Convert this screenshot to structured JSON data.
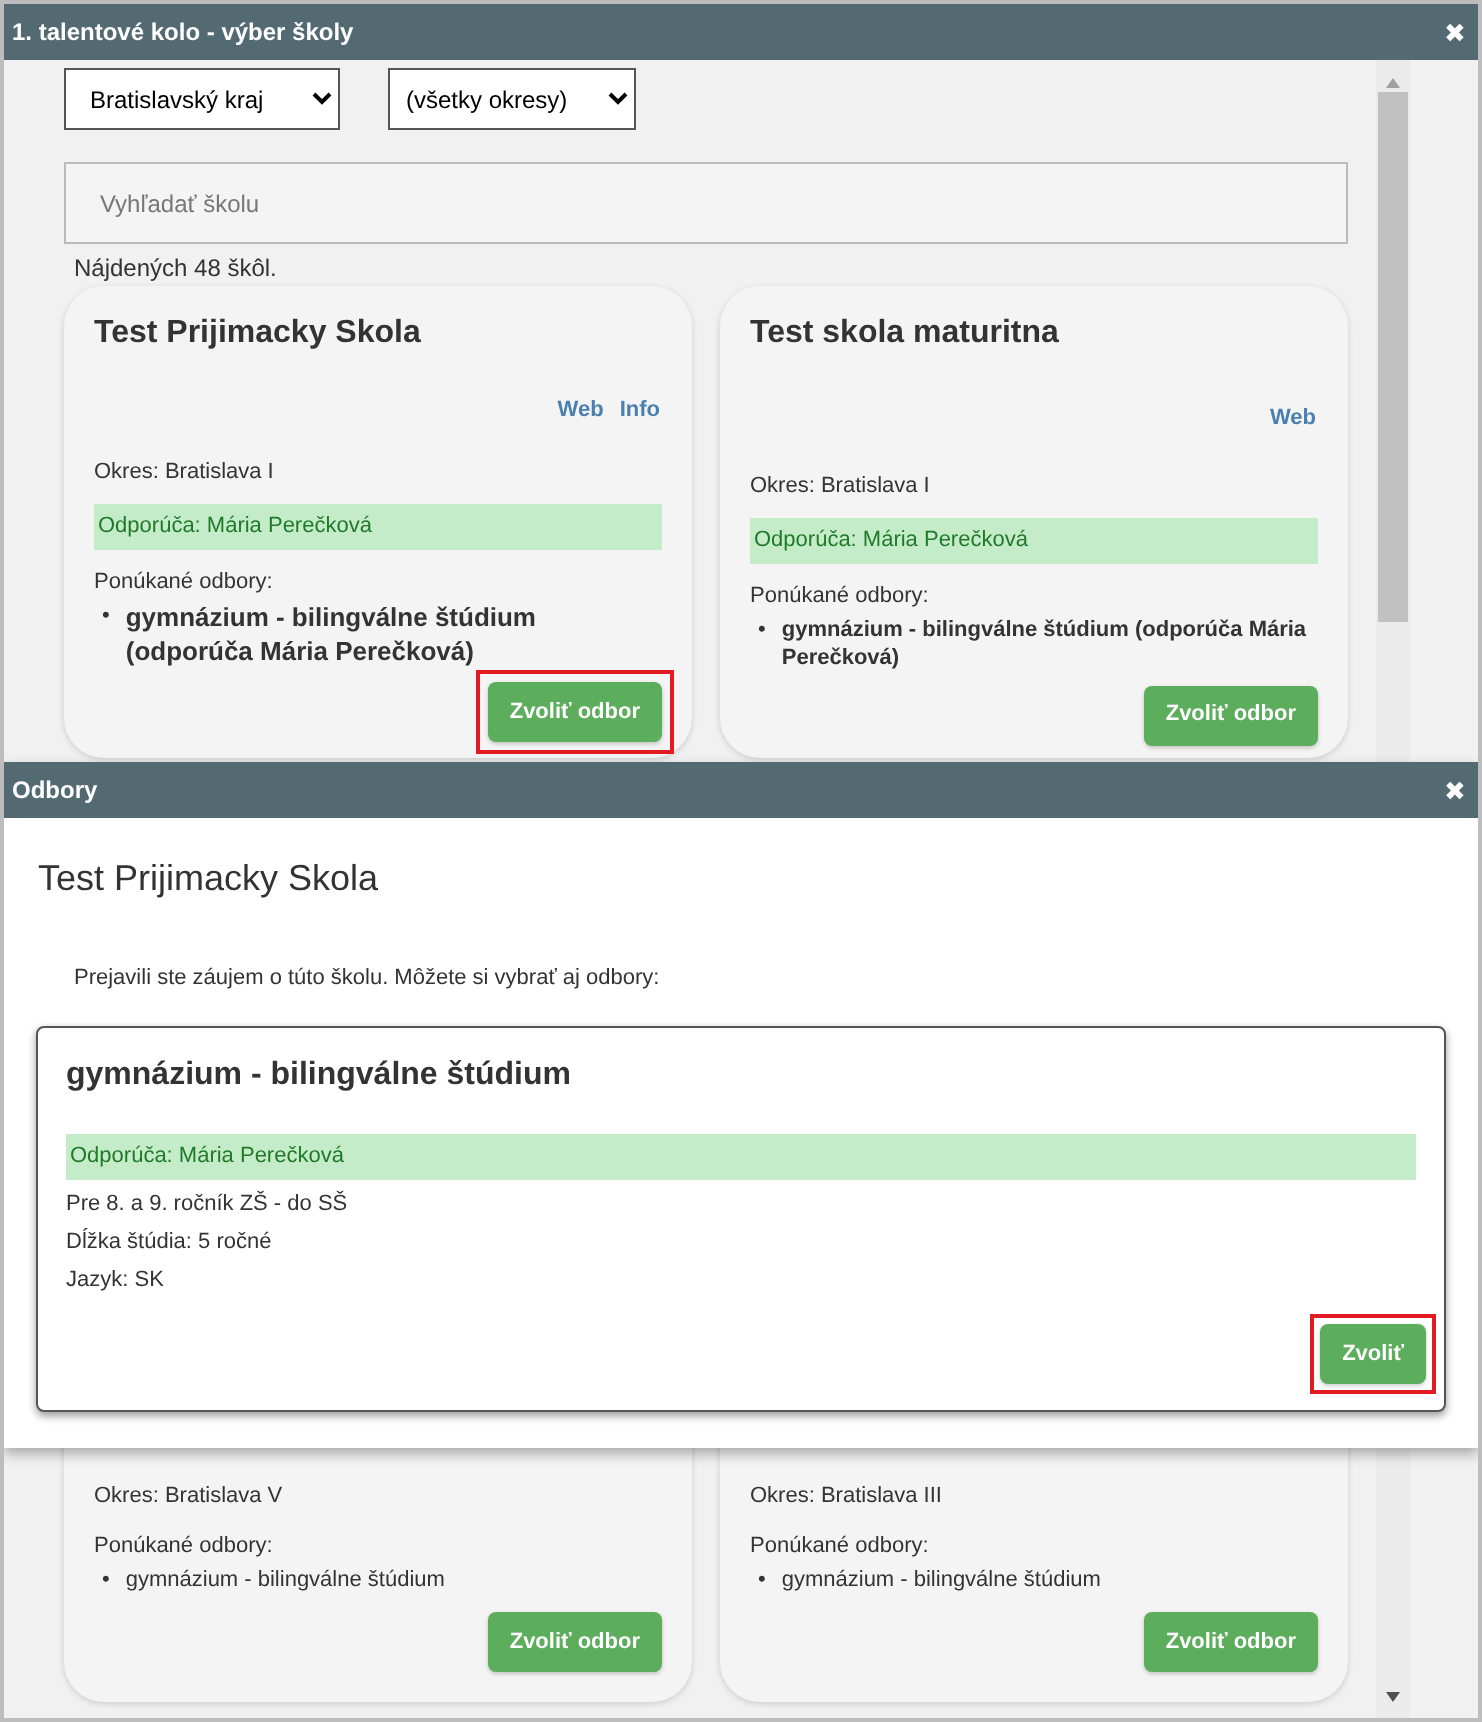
{
  "window": {
    "title": "1. talentové kolo - výber školy",
    "close": "✖"
  },
  "filters": {
    "region": "Bratislavský kraj",
    "district": "(všetky okresy)",
    "search_placeholder": "Vyhľadať školu",
    "result_count": "Nájdených 48 škôl."
  },
  "schools": [
    {
      "name": "Test Prijimacky Skola",
      "links": [
        "Web",
        "Info"
      ],
      "district": "Okres: Bratislava I",
      "recommendation": "Odporúča: Mária Perečková",
      "programs_label": "Ponúkané odbory:",
      "programs": [
        {
          "text": "gymnázium - bilingválne štúdium (odporúča Mária Perečková)",
          "kind": "headline",
          "marker": "•"
        }
      ],
      "button": "Zvoliť odbor",
      "highlighted": true
    },
    {
      "name": "Test skola maturitna",
      "links": [
        "Web"
      ],
      "district": "Okres: Bratislava I",
      "recommendation": "Odporúča: Mária Perečková",
      "programs_label": "Ponúkané odbory:",
      "programs": [
        {
          "text": "gymnázium - bilingválne štúdium (odporúča Mária Perečková)",
          "kind": "recommended",
          "marker": "•"
        }
      ],
      "button": "Zvoliť odbor",
      "highlighted": false
    },
    {
      "district": "Okres: Bratislava V",
      "programs_label": "Ponúkané odbory:",
      "programs": [
        {
          "text": "gymnázium - bilingválne štúdium",
          "kind": "plain",
          "marker": "•"
        }
      ],
      "button": "Zvoliť odbor",
      "highlighted": false
    },
    {
      "district": "Okres: Bratislava III",
      "programs_label": "Ponúkané odbory:",
      "programs": [
        {
          "text": "gymnázium - bilingválne štúdium",
          "kind": "plain",
          "marker": "•"
        }
      ],
      "button": "Zvoliť odbor",
      "highlighted": false
    }
  ],
  "modal": {
    "title": "Odbory",
    "close": "✖",
    "school": "Test Prijimacky Skola",
    "intro": "Prejavili ste záujem o túto školu. Môžete si vybrať aj odbory:",
    "programs": [
      {
        "name": "gymnázium - bilingválne štúdium",
        "recommendation": "Odporúča: Mária Perečková",
        "details": [
          "Pre 8. a 9. ročník ZŠ - do SŠ",
          "Dĺžka štúdia: 5 ročné",
          "Jazyk: SK"
        ],
        "button": "Zvoliť",
        "highlighted": true
      }
    ]
  }
}
